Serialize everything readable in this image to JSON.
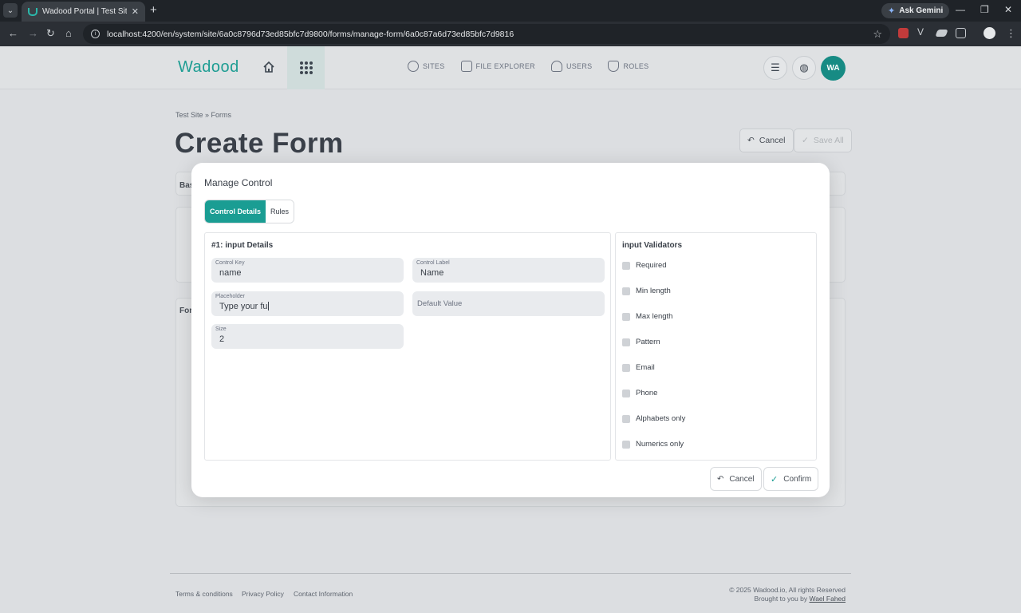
{
  "browser": {
    "tab_title": "Wadood Portal | Test Site - Crea",
    "new_tab": "+",
    "ask_gemini": "Ask Gemini",
    "url": "localhost:4200/en/system/site/6a0c8796d73ed85bfc7d9800/forms/manage-form/6a0c87a6d73ed85bfc7d9816"
  },
  "header": {
    "logo": "Wadood",
    "nav": [
      {
        "label": "SITES"
      },
      {
        "label": "FILE EXPLORER"
      },
      {
        "label": "USERS"
      },
      {
        "label": "ROLES"
      }
    ],
    "avatar": "WA"
  },
  "page": {
    "breadcrumb": "Test Site  » Forms",
    "title": "Create Form",
    "cancel": "Cancel",
    "save_all": "Save All",
    "bg_label_1": "Bas",
    "bg_label_2": "For"
  },
  "modal": {
    "title": "Manage Control",
    "tabs": [
      "Control Details",
      "Rules"
    ],
    "details_heading": "#1: input Details",
    "fields": {
      "control_key": {
        "label": "Control Key",
        "value": "name"
      },
      "control_label": {
        "label": "Control Label",
        "value": "Name"
      },
      "placeholder": {
        "label": "Placeholder",
        "value": "Type your fu"
      },
      "default_value": {
        "placeholder": "Default Value"
      },
      "size": {
        "label": "Size",
        "value": "2"
      }
    },
    "validators_heading": "input Validators",
    "validators": [
      "Required",
      "Min length",
      "Max length",
      "Pattern",
      "Email",
      "Phone",
      "Alphabets only",
      "Numerics only"
    ],
    "cancel": "Cancel",
    "confirm": "Confirm"
  },
  "footer": {
    "links": [
      "Terms & conditions",
      "Privacy Policy",
      "Contact Information"
    ],
    "copyright": "© 2025 Wadood.io, All rights Reserved",
    "brought_by": "Brought to you by",
    "author": "Wael Fahed"
  },
  "colors": {
    "accent": "#1a9d93",
    "avatar_bg": "#178b84"
  }
}
